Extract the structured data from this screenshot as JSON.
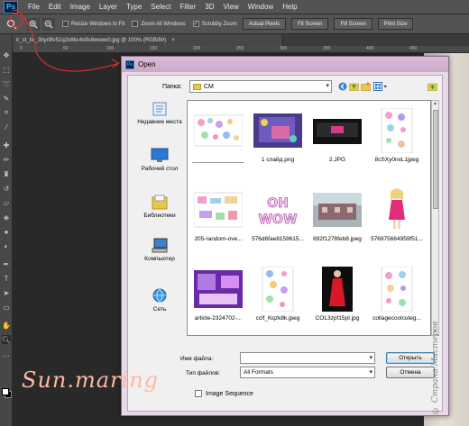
{
  "app": {
    "logo": "Ps"
  },
  "menu": [
    "File",
    "Edit",
    "Image",
    "Layer",
    "Type",
    "Select",
    "Filter",
    "3D",
    "View",
    "Window",
    "Help"
  ],
  "options": {
    "tool_icon": "zoom-icon",
    "checks": [
      {
        "label": "Resize Windows to Fit",
        "checked": false
      },
      {
        "label": "Zoom All Windows",
        "checked": false
      },
      {
        "label": "Scrubby Zoom",
        "checked": true
      }
    ],
    "buttons": [
      "Actual Pixels",
      "Fit Screen",
      "Fill Screen",
      "Print Size"
    ]
  },
  "document": {
    "tab_title": "ir_st_tic_3hyr8fv52q2o8kc4o9s8wowo0.jpg @ 100% (RGB/8#)",
    "close": "×"
  },
  "ruler": [
    "0",
    "50",
    "100",
    "150",
    "200",
    "250",
    "300",
    "350",
    "400",
    "450"
  ],
  "dialog": {
    "title": "Open",
    "look_in_label": "Папка:",
    "look_in_value": "CM",
    "places": [
      {
        "label": "Недавние места",
        "icon": "recent-places-icon"
      },
      {
        "label": "Рабочий стол",
        "icon": "desktop-icon"
      },
      {
        "label": "Библиотеки",
        "icon": "libraries-icon"
      },
      {
        "label": "Компьютер",
        "icon": "computer-icon"
      },
      {
        "label": "Сеть",
        "icon": "network-icon"
      }
    ],
    "files": [
      {
        "name": "________________",
        "thumb": "stickers-thumb"
      },
      {
        "name": "1 слайд.png",
        "thumb": "slide-thumb"
      },
      {
        "name": "2.JPG",
        "thumb": "screen-thumb"
      },
      {
        "name": "8cSXy0nxL1jpeg",
        "thumb": "stickers-thumb"
      },
      {
        "name": "205-random-ove...",
        "thumb": "stickers-thumb"
      },
      {
        "name": "576d6fae8159615...",
        "thumb": "ohwow-thumb"
      },
      {
        "name": "692f1278feb8.jpeg",
        "thumb": "photo-thumb"
      },
      {
        "name": "576975664959f51...",
        "thumb": "doll-thumb"
      },
      {
        "name": "article-2324702-...",
        "thumb": "room-thumb"
      },
      {
        "name": "cclf_Kqzk8k.jpeg",
        "thumb": "stickers-thumb"
      },
      {
        "name": "COL3zpf15pI.jpg",
        "thumb": "dress-thumb"
      },
      {
        "name": "collagecoolcuteg...",
        "thumb": "stickers-thumb"
      }
    ],
    "filename_label": "Имя файла:",
    "filename_value": "",
    "filetype_label": "Тип файлов:",
    "filetype_value": "All Formats",
    "open_button": "Открыть",
    "cancel_button": "Отмена",
    "image_sequence": {
      "label": "Image Sequence",
      "checked": false
    }
  },
  "signature": "Sun.maring",
  "watermark": "© Страна Мастеров"
}
